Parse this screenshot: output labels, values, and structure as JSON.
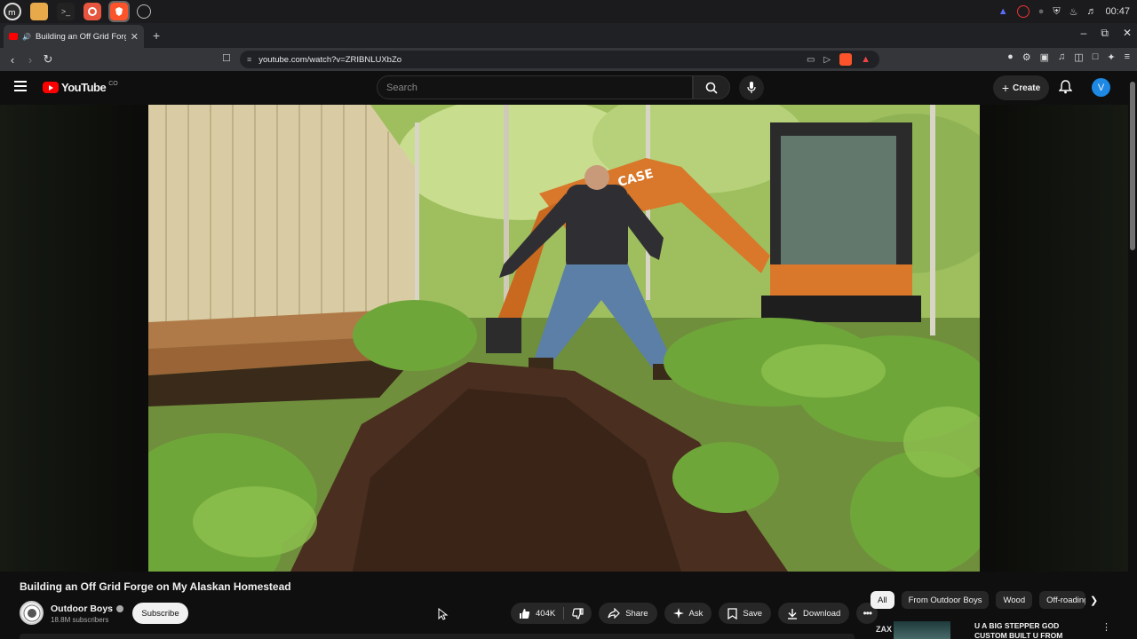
{
  "browser": {
    "tab_title": "Building an Off Grid Forge",
    "url": "youtube.com/watch?v=ZRIBNLUXbZo"
  },
  "system": {
    "clock": "00:47"
  },
  "youtube": {
    "logo_text": "YouTube",
    "logo_suffix": "CO",
    "search_placeholder": "Search",
    "create_label": "Create",
    "avatar_letter": "V"
  },
  "video": {
    "title": "Building an Off Grid Forge on My Alaskan Homestead",
    "channel_name": "Outdoor Boys",
    "subscribers": "18.8M subscribers",
    "subscribe_label": "Subscribe",
    "like_count": "404K",
    "share_label": "Share",
    "ask_label": "Ask",
    "save_label": "Save",
    "download_label": "Download",
    "scene_sign": "CASE"
  },
  "chips": [
    "All",
    "From Outdoor Boys",
    "Wood",
    "Off-roading"
  ],
  "recommendation": {
    "badge": "ZAX",
    "title_line1": "U A BIG STEPPER GOD",
    "title_line2": "CUSTOM BUILT U FROM"
  },
  "colors": {
    "accent_red": "#ff0000",
    "avatar_blue": "#1e88e5",
    "background": "#0f0f0f"
  }
}
